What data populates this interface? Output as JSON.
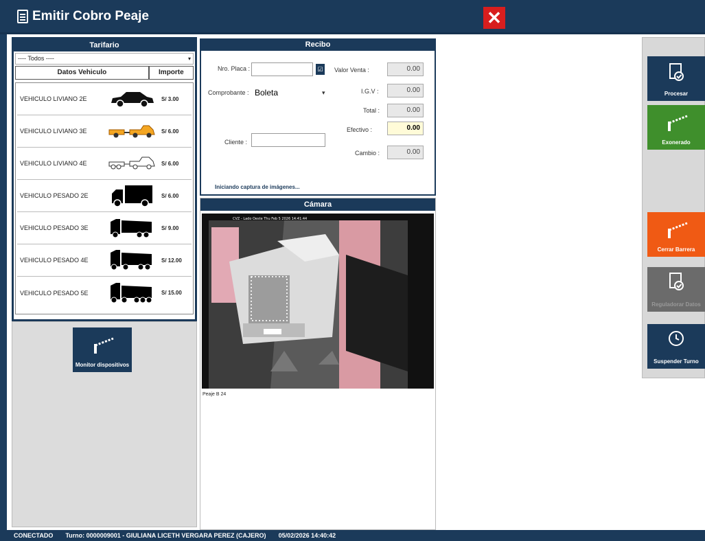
{
  "window": {
    "title": "Emitir Cobro Peaje",
    "close_label": "✕"
  },
  "tarifario": {
    "header": "Tarifario",
    "select_value": "---- Todos ----",
    "col_vehicle": "Datos Vehiculo",
    "col_price": "Importe",
    "items": [
      {
        "name": "VEHICULO LIVIANO 2E",
        "price": "S/ 3.00",
        "icon": "car-icon"
      },
      {
        "name": "VEHICULO LIVIANO 3E",
        "price": "S/ 6.00",
        "icon": "pickup-trailer-icon"
      },
      {
        "name": "VEHICULO LIVIANO 4E",
        "price": "S/ 6.00",
        "icon": "pickup-double-trailer-icon"
      },
      {
        "name": "VEHICULO PESADO 2E",
        "price": "S/ 6.00",
        "icon": "truck-2-axle-icon"
      },
      {
        "name": "VEHICULO PESADO 3E",
        "price": "S/ 9.00",
        "icon": "truck-3-axle-icon"
      },
      {
        "name": "VEHICULO PESADO 4E",
        "price": "S/ 12.00",
        "icon": "truck-4-axle-icon"
      },
      {
        "name": "VEHICULO PESADO 5E",
        "price": "S/ 15.00",
        "icon": "truck-5-axle-icon"
      }
    ]
  },
  "monitor": {
    "label": "Monitor dispositivos"
  },
  "recibo": {
    "header": "Recibo",
    "placa_label": "Nro. Placa :",
    "placa_value": "",
    "comprobante_label": "Comprobante :",
    "comprobante_value": "Boleta",
    "cliente_label": "Cliente :",
    "cliente_value": "",
    "valor_venta_label": "Valor Venta :",
    "valor_venta": "0.00",
    "igv_label": "I.G.V :",
    "igv": "0.00",
    "total_label": "Total :",
    "total": "0.00",
    "efectivo_label": "Efectivo :",
    "efectivo": "0.00",
    "cambio_label": "Cambio :",
    "cambio": "0.00",
    "status": "Iniciando captura de imágenes..."
  },
  "camara": {
    "header": "Cámara",
    "overlay": "CVZ - Lado Oeste Thu Feb 5 2026 14:41:44",
    "caption": "Peaje B 24"
  },
  "actions": [
    {
      "label": "Procesar",
      "icon": "document-check-icon",
      "color": "#1b3a5a"
    },
    {
      "label": "Exonerado",
      "icon": "barrier-icon",
      "color": "#3f8f2c"
    },
    {
      "label": "Cerrar Barrera",
      "icon": "barrier-icon",
      "color": "#f05a14"
    },
    {
      "label": "Reguladorar Datos",
      "icon": "document-check-icon",
      "color": "#6b6b6b"
    },
    {
      "label": "Suspender Turno",
      "icon": "clock-icon",
      "color": "#1b3a5a"
    }
  ],
  "statusbar": {
    "connection": "CONECTADO",
    "turno": "Turno: 0000009001 - GIULIANA LICETH VERGARA PEREZ (CAJERO)",
    "datetime": "05/02/2026 14:40:42"
  }
}
